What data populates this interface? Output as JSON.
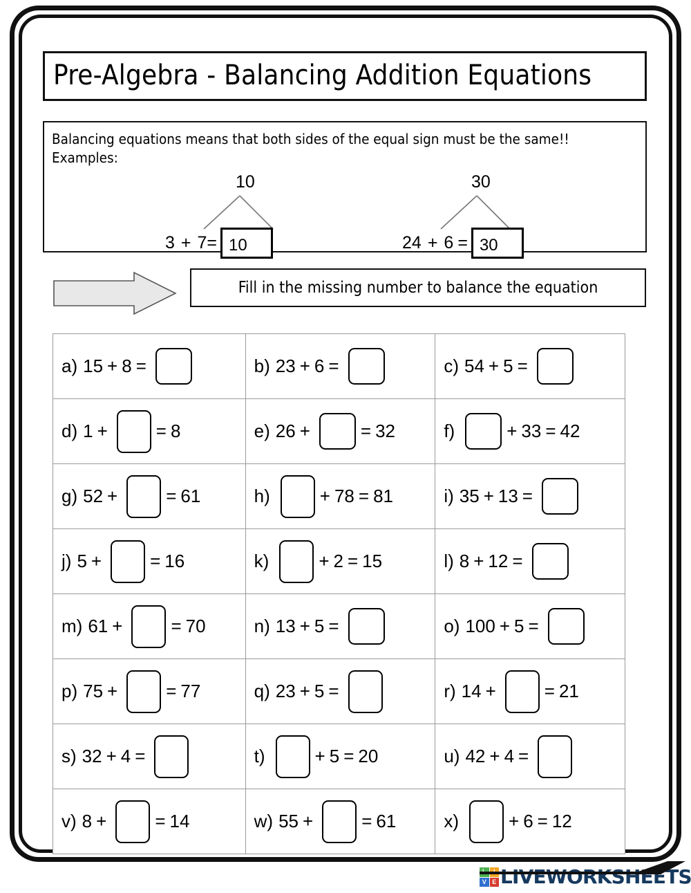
{
  "title": "Pre-Algebra - Balancing Addition Equations",
  "intro": {
    "line1": "Balancing equations means that both sides of the equal sign must be the same!!",
    "line2": "Examples:"
  },
  "examples": [
    {
      "sum": "10",
      "addend1": "3",
      "operator": "+",
      "addend2": "7",
      "equals": "=",
      "answer": "10"
    },
    {
      "sum": "30",
      "addend1": "24",
      "operator": "+",
      "addend2": "6",
      "equals": "=",
      "answer": "30"
    }
  ],
  "instruction": "Fill in the missing number to balance the equation",
  "exercises": [
    {
      "label": "a)",
      "parts": [
        "15",
        "+",
        "8",
        "="
      ],
      "box_after": 4,
      "box_style": "sq",
      "tail": []
    },
    {
      "label": "b)",
      "parts": [
        "23",
        "+",
        "6",
        "="
      ],
      "box_after": 4,
      "box_style": "sq",
      "tail": []
    },
    {
      "label": "c)",
      "parts": [
        "54",
        "+",
        "5",
        "="
      ],
      "box_after": 4,
      "box_style": "sq",
      "tail": []
    },
    {
      "label": "d)",
      "parts": [
        "1",
        "+"
      ],
      "box_after": 2,
      "box_style": "tall",
      "tail": [
        "=",
        "8"
      ]
    },
    {
      "label": "e)",
      "parts": [
        "26",
        "+"
      ],
      "box_after": 2,
      "box_style": "sq",
      "tail": [
        "=",
        "32"
      ]
    },
    {
      "label": "f)",
      "parts": [],
      "box_after": 0,
      "box_style": "sq",
      "tail": [
        "+",
        "33",
        "=",
        "42"
      ]
    },
    {
      "label": "g)",
      "parts": [
        "52",
        "+"
      ],
      "box_after": 2,
      "box_style": "tall",
      "tail": [
        "=",
        "61"
      ]
    },
    {
      "label": "h)",
      "parts": [],
      "box_after": 0,
      "box_style": "tall",
      "tail": [
        "+",
        "78",
        "=",
        "81"
      ]
    },
    {
      "label": "i)",
      "parts": [
        "35",
        "+",
        "13",
        "="
      ],
      "box_after": 4,
      "box_style": "sq",
      "tail": []
    },
    {
      "label": "j)",
      "parts": [
        "5",
        "+"
      ],
      "box_after": 2,
      "box_style": "tall",
      "tail": [
        "=",
        "16"
      ]
    },
    {
      "label": "k)",
      "parts": [],
      "box_after": 0,
      "box_style": "tall",
      "tail": [
        "+",
        "2",
        "=",
        "15"
      ]
    },
    {
      "label": "l)",
      "parts": [
        "8",
        "+",
        "12",
        "="
      ],
      "box_after": 4,
      "box_style": "sq",
      "tail": []
    },
    {
      "label": "m)",
      "parts": [
        "61",
        "+"
      ],
      "box_after": 2,
      "box_style": "tall",
      "tail": [
        "=",
        "70"
      ]
    },
    {
      "label": "n)",
      "parts": [
        "13",
        "+",
        "5",
        "="
      ],
      "box_after": 4,
      "box_style": "sq",
      "tail": []
    },
    {
      "label": "o)",
      "parts": [
        "100",
        "+",
        "5",
        "="
      ],
      "box_after": 4,
      "box_style": "sq",
      "tail": []
    },
    {
      "label": "p)",
      "parts": [
        "75",
        "+"
      ],
      "box_after": 2,
      "box_style": "tall",
      "tail": [
        "=",
        "77"
      ]
    },
    {
      "label": "q)",
      "parts": [
        "23",
        "+",
        "5",
        "="
      ],
      "box_after": 4,
      "box_style": "tall",
      "tail": []
    },
    {
      "label": "r)",
      "parts": [
        "14",
        "+"
      ],
      "box_after": 2,
      "box_style": "tall",
      "tail": [
        "=",
        "21"
      ]
    },
    {
      "label": "s)",
      "parts": [
        "32",
        "+",
        "4",
        "="
      ],
      "box_after": 4,
      "box_style": "tall",
      "tail": []
    },
    {
      "label": "t)",
      "parts": [],
      "box_after": 0,
      "box_style": "tall",
      "tail": [
        "+",
        "5",
        "=",
        "20"
      ]
    },
    {
      "label": "u)",
      "parts": [
        "42",
        "+",
        "4",
        "="
      ],
      "box_after": 4,
      "box_style": "tall",
      "tail": []
    },
    {
      "label": "v)",
      "parts": [
        "8",
        "+"
      ],
      "box_after": 2,
      "box_style": "tall",
      "tail": [
        "=",
        "14"
      ]
    },
    {
      "label": "w)",
      "parts": [
        "55",
        "+"
      ],
      "box_after": 2,
      "box_style": "tall",
      "tail": [
        "=",
        "61"
      ]
    },
    {
      "label": "x)",
      "parts": [],
      "box_after": 0,
      "box_style": "tall",
      "tail": [
        "+",
        "6",
        "=",
        "12"
      ]
    }
  ],
  "footer": {
    "brand": "LIVEWORKSHEETS",
    "icon_letters": [
      "L",
      "I",
      "V",
      "E"
    ],
    "icon_colors": [
      "#4caf50",
      "#f5a623",
      "#2f6fd0",
      "#d63b2f"
    ],
    "brand_color": "#16395e"
  }
}
